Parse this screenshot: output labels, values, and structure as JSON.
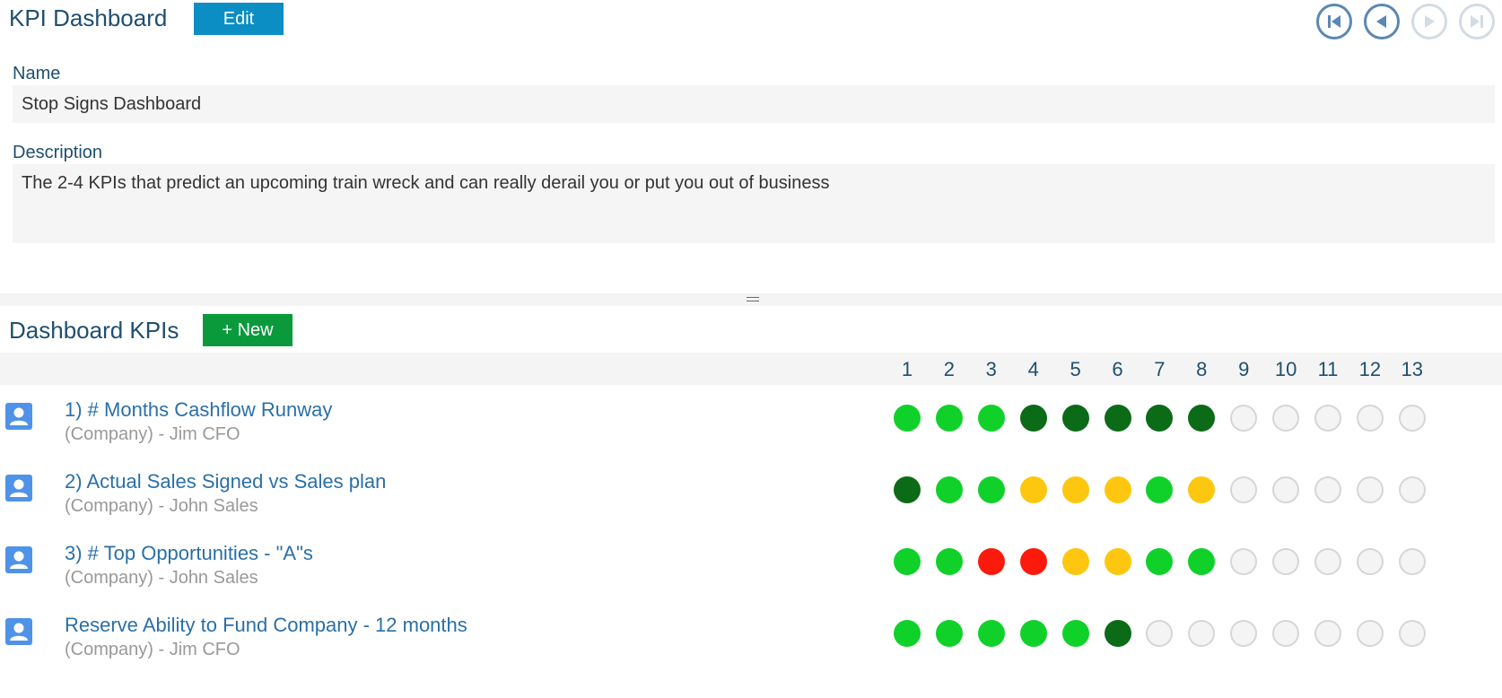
{
  "header": {
    "title": "KPI Dashboard",
    "edit_label": "Edit"
  },
  "nav": {
    "buttons": [
      {
        "name": "first",
        "enabled": true
      },
      {
        "name": "previous",
        "enabled": true
      },
      {
        "name": "next",
        "enabled": false
      },
      {
        "name": "last",
        "enabled": false
      }
    ]
  },
  "form": {
    "name_label": "Name",
    "name_value": "Stop Signs Dashboard",
    "description_label": "Description",
    "description_value": "The 2-4 KPIs that predict an upcoming train wreck and can really derail you or put you out of business"
  },
  "kpis_section": {
    "title": "Dashboard KPIs",
    "new_label": "+ New",
    "periods": [
      "1",
      "2",
      "3",
      "4",
      "5",
      "6",
      "7",
      "8",
      "9",
      "10",
      "11",
      "12",
      "13"
    ],
    "status_colors": {
      "dark_green": "#0b6b16",
      "green": "#10d12a",
      "yellow": "#fdc70f",
      "red": "#fb1a0c"
    },
    "rows": [
      {
        "name": "1) # Months Cashflow Runway",
        "owner": "(Company) - Jim CFO",
        "statuses": [
          "green",
          "green",
          "green",
          "dark_green",
          "dark_green",
          "dark_green",
          "dark_green",
          "dark_green",
          "empty",
          "empty",
          "empty",
          "empty",
          "empty"
        ]
      },
      {
        "name": "2) Actual Sales Signed vs Sales plan",
        "owner": "(Company) - John Sales",
        "statuses": [
          "dark_green",
          "green",
          "green",
          "yellow",
          "yellow",
          "yellow",
          "green",
          "yellow",
          "empty",
          "empty",
          "empty",
          "empty",
          "empty"
        ]
      },
      {
        "name": "3) # Top Opportunities - \"A\"s",
        "owner": "(Company) - John Sales",
        "statuses": [
          "green",
          "green",
          "red",
          "red",
          "yellow",
          "yellow",
          "green",
          "green",
          "empty",
          "empty",
          "empty",
          "empty",
          "empty"
        ]
      },
      {
        "name": "Reserve Ability to Fund Company - 12 months",
        "owner": "(Company) - Jim CFO",
        "statuses": [
          "green",
          "green",
          "green",
          "green",
          "green",
          "dark_green",
          "empty",
          "empty",
          "empty",
          "empty",
          "empty",
          "empty",
          "empty"
        ]
      }
    ]
  }
}
